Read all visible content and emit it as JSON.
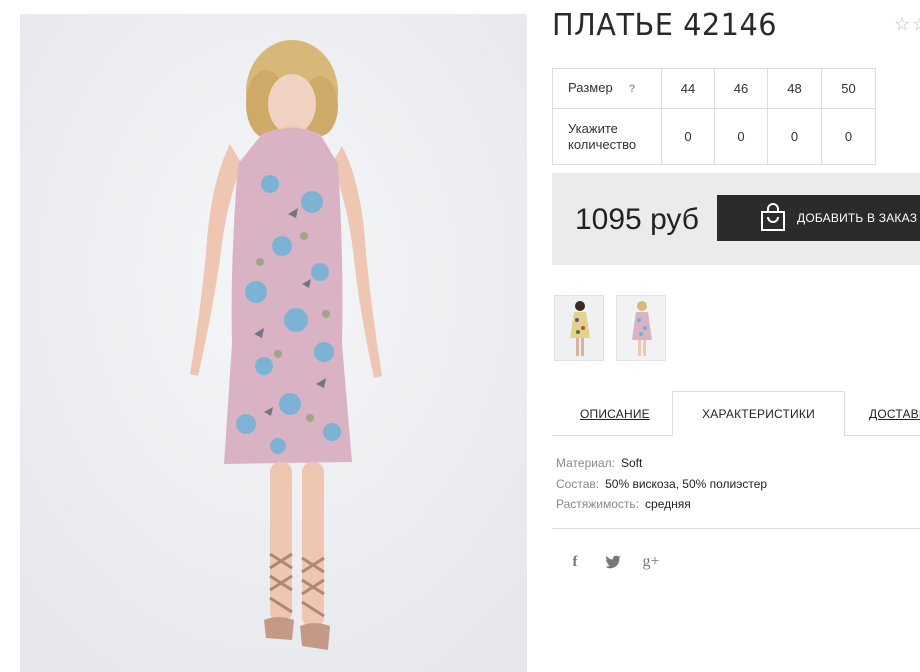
{
  "product": {
    "title": "ПЛАТЬЕ 42146",
    "favorite_icon": "star-outline-icon"
  },
  "size_table": {
    "size_label": "Размер",
    "help_mark": "?",
    "sizes": [
      "44",
      "46",
      "48",
      "50"
    ],
    "qty_label_line1": "Укажите",
    "qty_label_line2": "количество",
    "quantities": [
      "0",
      "0",
      "0",
      "0"
    ]
  },
  "price_panel": {
    "price": "1095 руб",
    "add_button_label": "ДОБАВИТЬ В ЗАКАЗ",
    "bag_icon": "shopping-bag-icon"
  },
  "tabs": {
    "description": "ОПИСАНИЕ",
    "characteristics": "ХАРАКТЕРИСТИКИ",
    "delivery": "ДОСТАВКА"
  },
  "characteristics": [
    {
      "key": "Материал:",
      "value": "Soft"
    },
    {
      "key": "Состав:",
      "value": "50% вискоза, 50% полиэстер"
    },
    {
      "key": "Растяжимость:",
      "value": "средняя"
    }
  ],
  "social": {
    "facebook": "f",
    "twitter_icon": "twitter-icon",
    "google_plus": "g+"
  },
  "colors": {
    "button_bg": "#2b2b2b",
    "price_panel_bg": "#ebebeb",
    "dress_pink": "#d9b3c4",
    "print_blue": "#6cb4d8"
  }
}
